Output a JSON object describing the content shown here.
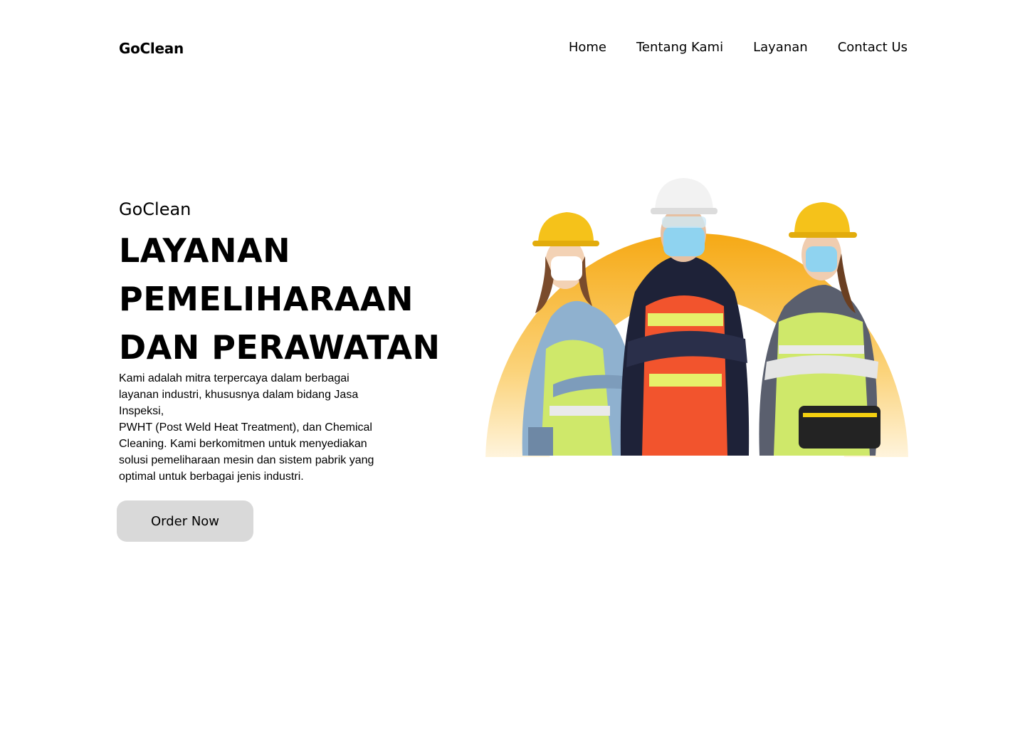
{
  "header": {
    "brand": "GoClean",
    "nav": [
      "Home",
      "Tentang Kami",
      "Layanan",
      "Contact Us"
    ]
  },
  "hero": {
    "eyebrow": "GoClean",
    "headline_lines": [
      "LAYANAN",
      "PEMELIHARAAN",
      "DAN PERAWATAN"
    ],
    "description_lines": [
      "Kami adalah mitra terpercaya dalam berbagai",
      "layanan industri, khususnya dalam bidang Jasa",
      "Inspeksi,",
      "PWHT (Post Weld Heat Treatment), dan Chemical",
      "Cleaning. Kami berkomitmen untuk menyediakan",
      "solusi pemeliharaan mesin dan sistem pabrik yang",
      "optimal untuk berbagai jenis industri."
    ],
    "cta_label": "Order Now",
    "image_icon": "workers-in-safety-gear-illustration"
  },
  "colors": {
    "arc_top": "#f6a915",
    "arc_bottom": "#fff3d6",
    "button_bg": "#d9d9d9",
    "helmet_yellow": "#f5c21a",
    "helmet_white": "#f2f2f2",
    "vest_green": "#cfe86a",
    "vest_orange": "#f2542d"
  }
}
